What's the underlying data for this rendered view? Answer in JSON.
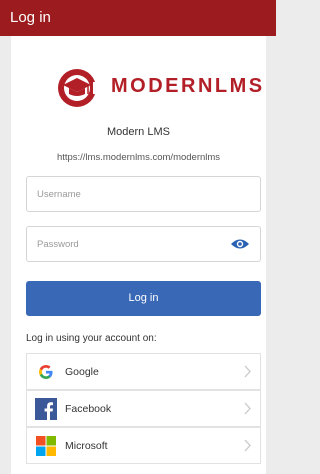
{
  "header": {
    "title": "Log in"
  },
  "site": {
    "logo_text": "MODERNLMS",
    "name": "Modern LMS",
    "url": "https://lms.modernlms.com/modernlms"
  },
  "form": {
    "username_placeholder": "Username",
    "password_placeholder": "Password",
    "login_label": "Log in"
  },
  "alt_login": {
    "label": "Log in using your account on:",
    "providers": [
      {
        "name": "Google",
        "icon": "google-icon"
      },
      {
        "name": "Facebook",
        "icon": "facebook-icon"
      },
      {
        "name": "Microsoft",
        "icon": "microsoft-icon"
      }
    ]
  },
  "colors": {
    "header": "#9b1b1e",
    "brand": "#b21f27",
    "button": "#3968b7",
    "eye": "#2a62b3"
  }
}
